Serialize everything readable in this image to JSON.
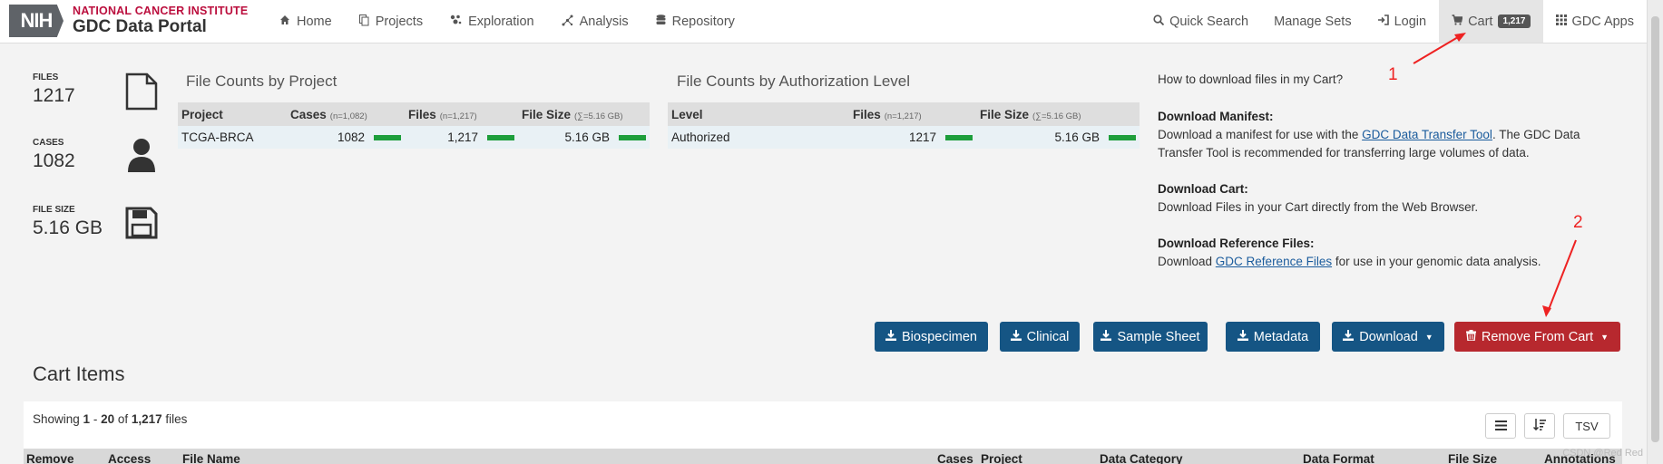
{
  "header": {
    "logo_short": "NIH",
    "institute": "NATIONAL CANCER INSTITUTE",
    "portal": "GDC Data Portal",
    "nav_left": [
      {
        "label": "Home",
        "icon": "home-icon"
      },
      {
        "label": "Projects",
        "icon": "projects-icon"
      },
      {
        "label": "Exploration",
        "icon": "exploration-icon"
      },
      {
        "label": "Analysis",
        "icon": "analysis-icon"
      },
      {
        "label": "Repository",
        "icon": "repository-icon"
      }
    ],
    "nav_right": {
      "quick_search": "Quick Search",
      "manage_sets": "Manage Sets",
      "login": "Login",
      "cart": "Cart",
      "cart_count": "1,217",
      "gdc_apps": "GDC Apps"
    }
  },
  "summary": {
    "files_label": "FILES",
    "files_value": "1217",
    "cases_label": "CASES",
    "cases_value": "1082",
    "size_label": "FILE SIZE",
    "size_value": "5.16 GB"
  },
  "project_table": {
    "title": "File Counts by Project",
    "headers": {
      "project": "Project",
      "cases": "Cases",
      "cases_sub": "(n=1,082)",
      "files": "Files",
      "files_sub": "(n=1,217)",
      "size": "File Size",
      "size_sub": "(∑=5.16 GB)"
    },
    "rows": [
      {
        "project": "TCGA-BRCA",
        "cases": "1082",
        "files": "1,217",
        "size": "5.16 GB"
      }
    ]
  },
  "auth_table": {
    "title": "File Counts by Authorization Level",
    "headers": {
      "level": "Level",
      "files": "Files",
      "files_sub": "(n=1,217)",
      "size": "File Size",
      "size_sub": "(∑=5.16 GB)"
    },
    "rows": [
      {
        "level": "Authorized",
        "files": "1217",
        "size": "5.16 GB"
      }
    ]
  },
  "help": {
    "question": "How to download files in my Cart?",
    "manifest_title": "Download Manifest:",
    "manifest_pre": "Download a manifest for use with the ",
    "manifest_link": "GDC Data Transfer Tool",
    "manifest_post": ". The GDC Data",
    "manifest_line2": "Transfer Tool is recommended for transferring large volumes of data.",
    "cart_title": "Download Cart:",
    "cart_text": "Download Files in your Cart directly from the Web Browser.",
    "ref_title": "Download Reference Files:",
    "ref_pre": "Download ",
    "ref_link": "GDC Reference Files",
    "ref_post": " for use in your genomic data analysis."
  },
  "actions": {
    "biospecimen": "Biospecimen",
    "clinical": "Clinical",
    "sample_sheet": "Sample Sheet",
    "metadata": "Metadata",
    "download": "Download",
    "remove": "Remove From Cart"
  },
  "cart_items": {
    "title": "Cart Items",
    "showing_pre": "Showing ",
    "range_start": "1",
    "range_sep": " - ",
    "range_end": "20",
    "of": " of ",
    "total": "1,217",
    "unit": " files",
    "tsv": "TSV",
    "columns": [
      "Remove",
      "Access",
      "File Name",
      "Cases",
      "Project",
      "Data Category",
      "Data Format",
      "File Size",
      "Annotations"
    ]
  },
  "annotations": {
    "one": "1",
    "two": "2"
  },
  "watermark": "CSDN @Red Red",
  "colors": {
    "nci_red": "#bb0e3d",
    "button_blue": "#155584",
    "button_red": "#b7282e",
    "bar_green": "#1d9e3b",
    "annotation_red": "#ee2222"
  }
}
